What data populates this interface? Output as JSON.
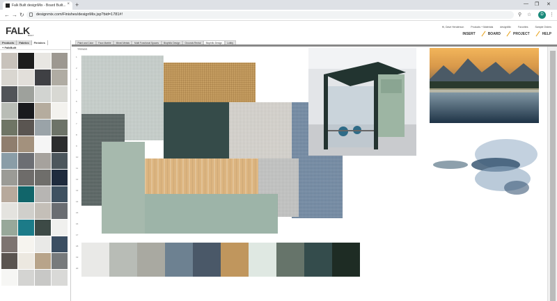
{
  "browser": {
    "tab_title": "Falk Built designMix - Board Built...",
    "tab_close": "×",
    "new_tab": "+",
    "url": "designmix.com/Finishes/designMix.jsp?bid=1781#!",
    "nav_back": "←",
    "nav_forward": "→",
    "nav_reload": "↻",
    "search_icon": "⚲",
    "star_icon": "☆",
    "avatar_letter": "D",
    "menu_icon": "⋮",
    "win_min": "—",
    "win_max": "❐",
    "win_close": "✕"
  },
  "header": {
    "logo": "FALK",
    "logo_sub": "BUILT",
    "top_links": [
      "Hi, Dave Henderson",
      "Products + Materials",
      "designMix",
      "Favorites",
      "Sample Orders"
    ],
    "nav": [
      "INSERT",
      "BOARD",
      "PROJECT",
      "HELP"
    ]
  },
  "left_panel": {
    "tabs": [
      "Products",
      "Fabrics",
      "Finishes"
    ],
    "active_tab": "Finishes",
    "folder": "+ FalkBuilt",
    "swatch_colors": [
      "#c8c2bb",
      "#1d1d1d",
      "#e8e6e2",
      "#9d9891",
      "#d9d6d0",
      "#e2dfda",
      "#3f4044",
      "#b0aca3",
      "#515458",
      "#9ea19c",
      "#d2d4d1",
      "#d8d8d3",
      "#b9bdb6",
      "#191a1d",
      "#b5ac9e",
      "#f3f2ee",
      "#6f7565",
      "#5a5551",
      "#9aa3a8",
      "#6d7368",
      "#8f7e6e",
      "#a3917d",
      "#f5f5f5",
      "#2c2d2e",
      "#8a9da7",
      "#6c6e73",
      "#a6a29d",
      "#4c565c",
      "#9b9b96",
      "#6e6c6a",
      "#6f6e6b",
      "#1f2b3e",
      "#b7a99c",
      "#11656a",
      "#b7b5b3",
      "#3f5161",
      "#e4e3df",
      "#d0cfcb",
      "#c4bfb8",
      "#6a6d72",
      "#98a89a",
      "#1c7b88",
      "#3d4a46",
      "#f0f0ee",
      "#7d7471",
      "#f6f4ef",
      "#e9e9e7",
      "#3b4e62",
      "#5a5450",
      "#ece8e0",
      "#b8a48a",
      "#777a7c",
      "#f6f6f4",
      "#d4d4d2",
      "#c8c8c6",
      "#d9d9d7"
    ]
  },
  "board": {
    "tabs": [
      "Paint and Color",
      "Faux Marble",
      "Mixed Metals",
      "Multi Functional Spaces",
      "Biophilic Design",
      "Grounds Rental",
      "Biophilic Design",
      "Lobby"
    ],
    "active_tab_index": 6,
    "trends_label": "TRENDS",
    "ruler": [
      "1",
      "2",
      "3",
      "4",
      "5",
      "6",
      "7",
      "8",
      "9",
      "10",
      "11",
      "12",
      "13",
      "14",
      "15",
      "16",
      "17",
      "18",
      "19",
      "20"
    ],
    "palette": [
      "#e9e9e7",
      "#b8bcb6",
      "#a9a9a1",
      "#6d8191",
      "#4a5868",
      "#c0965d",
      "#dfe8e2",
      "#66746a",
      "#344c4c",
      "#1e2c24"
    ]
  }
}
